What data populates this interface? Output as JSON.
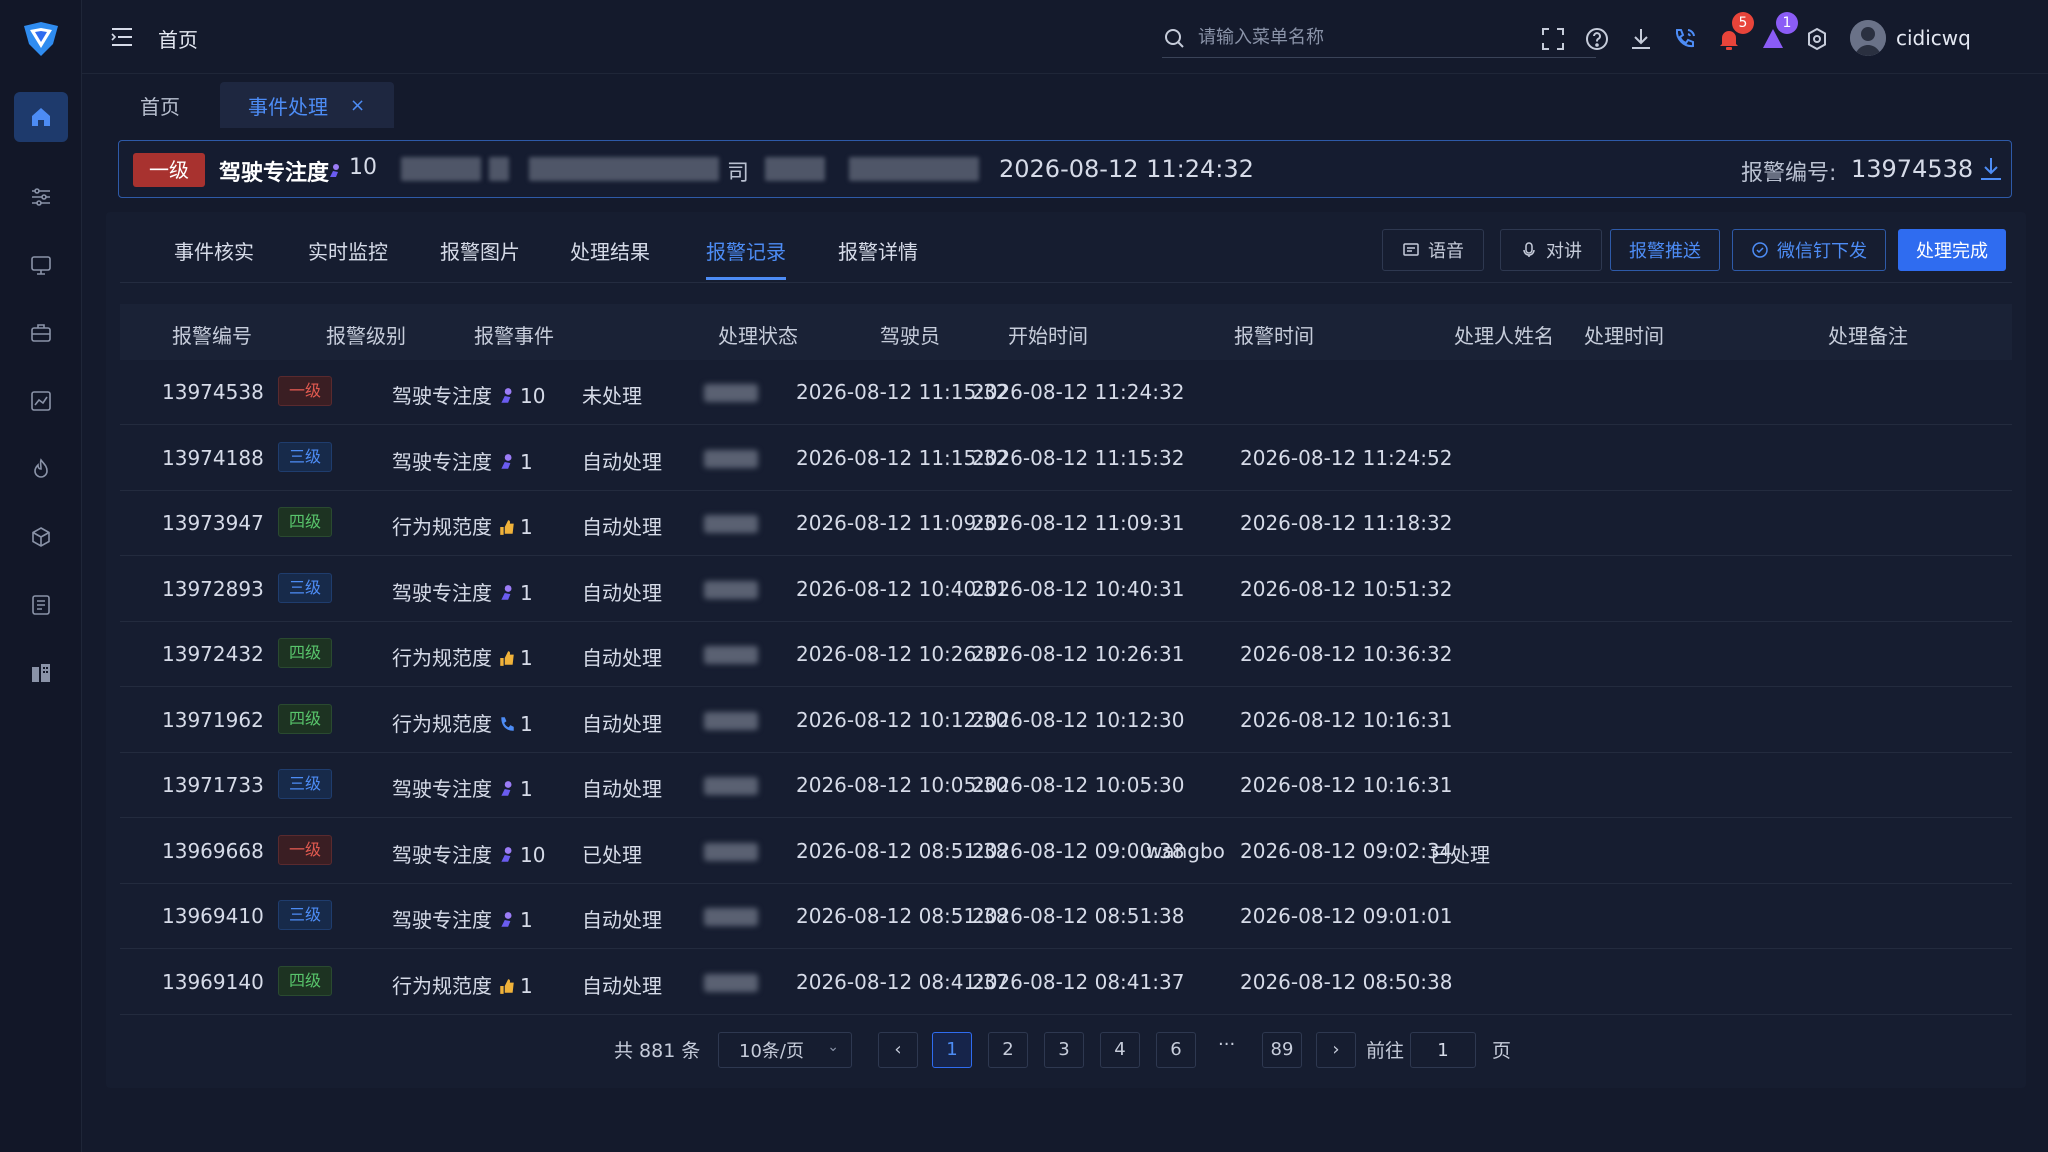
{
  "topbar": {
    "breadcrumb": "首页",
    "search_placeholder": "请输入菜单名称",
    "notifications_badge": "5",
    "messages_badge": "1",
    "username": "cidicwq"
  },
  "page_tabs": [
    {
      "label": "首页"
    },
    {
      "label": "事件处理",
      "close": "×"
    }
  ],
  "alert": {
    "level": "一级",
    "event": "驾驶专注度",
    "count": "10",
    "suffix": "司",
    "time": "2026-08-12 11:24:32",
    "id_label": "报警编号:",
    "id": "13974538"
  },
  "sub_tabs": [
    "事件核实",
    "实时监控",
    "报警图片",
    "处理结果",
    "报警记录",
    "报警详情"
  ],
  "actions": {
    "voice": "语音",
    "intercom": "对讲",
    "push": "报警推送",
    "wechat": "微信钉下发",
    "done": "处理完成"
  },
  "table": {
    "headers": [
      "报警编号",
      "报警级别",
      "报警事件",
      "处理状态",
      "驾驶员",
      "开始时间",
      "报警时间",
      "处理人姓名",
      "处理时间",
      "处理备注"
    ],
    "rows": [
      {
        "id": "13974538",
        "level": "一级",
        "lvl": "l1",
        "event": "驾驶专注度",
        "icon": "driver-focus-icon",
        "count": "10",
        "status": "未处理",
        "start": "2026-08-12 11:15:32",
        "alarm": "2026-08-12 11:24:32",
        "handler": "",
        "handle_time": "",
        "note": ""
      },
      {
        "id": "13974188",
        "level": "三级",
        "lvl": "l3",
        "event": "驾驶专注度",
        "icon": "driver-focus-icon",
        "count": "1",
        "status": "自动处理",
        "start": "2026-08-12 11:15:32",
        "alarm": "2026-08-12 11:15:32",
        "handler": "",
        "handle_time": "2026-08-12 11:24:52",
        "note": ""
      },
      {
        "id": "13973947",
        "level": "四级",
        "lvl": "l4",
        "event": "行为规范度",
        "icon": "thumb-icon",
        "count": "1",
        "status": "自动处理",
        "start": "2026-08-12 11:09:31",
        "alarm": "2026-08-12 11:09:31",
        "handler": "",
        "handle_time": "2026-08-12 11:18:32",
        "note": ""
      },
      {
        "id": "13972893",
        "level": "三级",
        "lvl": "l3",
        "event": "驾驶专注度",
        "icon": "driver-focus-icon",
        "count": "1",
        "status": "自动处理",
        "start": "2026-08-12 10:40:31",
        "alarm": "2026-08-12 10:40:31",
        "handler": "",
        "handle_time": "2026-08-12 10:51:32",
        "note": ""
      },
      {
        "id": "13972432",
        "level": "四级",
        "lvl": "l4",
        "event": "行为规范度",
        "icon": "thumb-icon",
        "count": "1",
        "status": "自动处理",
        "start": "2026-08-12 10:26:31",
        "alarm": "2026-08-12 10:26:31",
        "handler": "",
        "handle_time": "2026-08-12 10:36:32",
        "note": ""
      },
      {
        "id": "13971962",
        "level": "四级",
        "lvl": "l4",
        "event": "行为规范度",
        "icon": "phone-icon",
        "count": "1",
        "status": "自动处理",
        "start": "2026-08-12 10:12:30",
        "alarm": "2026-08-12 10:12:30",
        "handler": "",
        "handle_time": "2026-08-12 10:16:31",
        "note": ""
      },
      {
        "id": "13971733",
        "level": "三级",
        "lvl": "l3",
        "event": "驾驶专注度",
        "icon": "driver-focus-icon",
        "count": "1",
        "status": "自动处理",
        "start": "2026-08-12 10:05:30",
        "alarm": "2026-08-12 10:05:30",
        "handler": "",
        "handle_time": "2026-08-12 10:16:31",
        "note": ""
      },
      {
        "id": "13969668",
        "level": "一级",
        "lvl": "l1",
        "event": "驾驶专注度",
        "icon": "driver-focus-icon",
        "count": "10",
        "status": "已处理",
        "start": "2026-08-12 08:51:38",
        "alarm": "2026-08-12 09:00:38",
        "handler": "wangbo",
        "handle_time": "2026-08-12 09:02:34",
        "note": "已处理"
      },
      {
        "id": "13969410",
        "level": "三级",
        "lvl": "l3",
        "event": "驾驶专注度",
        "icon": "driver-focus-icon",
        "count": "1",
        "status": "自动处理",
        "start": "2026-08-12 08:51:38",
        "alarm": "2026-08-12 08:51:38",
        "handler": "",
        "handle_time": "2026-08-12 09:01:01",
        "note": ""
      },
      {
        "id": "13969140",
        "level": "四级",
        "lvl": "l4",
        "event": "行为规范度",
        "icon": "thumb-icon",
        "count": "1",
        "status": "自动处理",
        "start": "2026-08-12 08:41:37",
        "alarm": "2026-08-12 08:41:37",
        "handler": "",
        "handle_time": "2026-08-12 08:50:38",
        "note": ""
      }
    ]
  },
  "pagination": {
    "total": "共 881 条",
    "page_size": "10条/页",
    "pages": [
      "1",
      "2",
      "3",
      "4",
      "6"
    ],
    "ellipsis": "···",
    "last": "89",
    "goto_label": "前往",
    "goto_value": "1",
    "page_label": "页"
  },
  "colors": {
    "accent": "#2f6cf0",
    "level1": "#e15a50",
    "level3": "#4d8cf5",
    "level4": "#58c46b"
  }
}
